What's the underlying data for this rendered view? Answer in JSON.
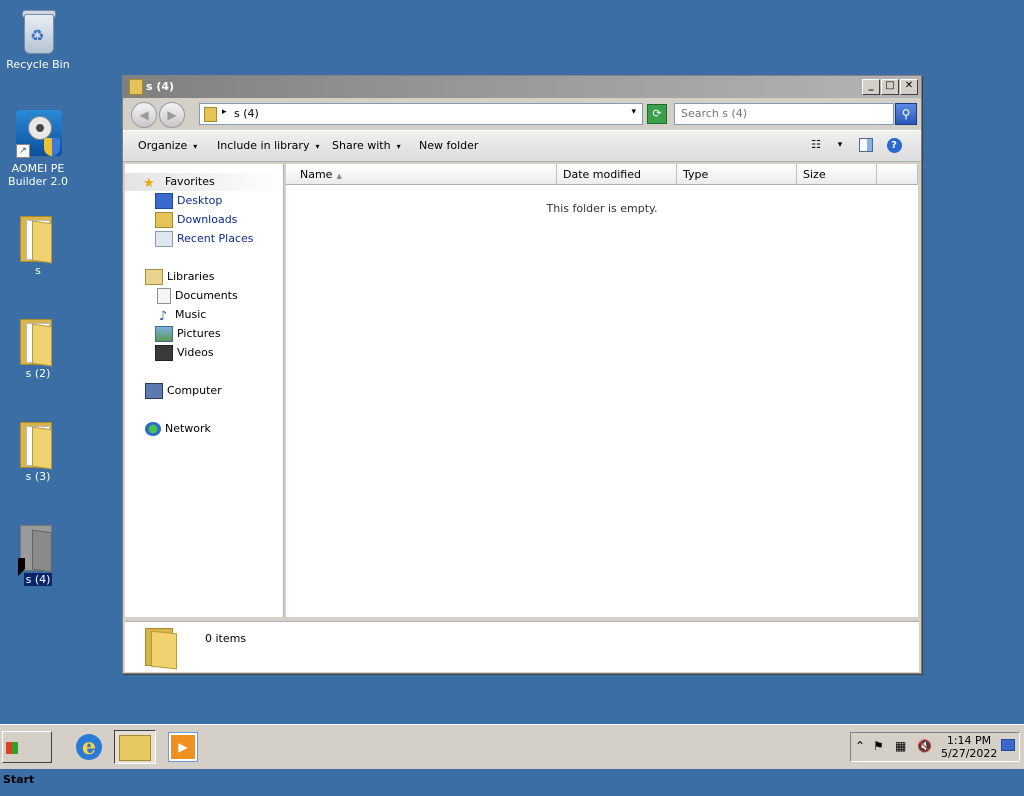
{
  "desktop": {
    "icons": [
      {
        "label": "Recycle Bin",
        "icon": "recycle-bin-icon"
      },
      {
        "label": "AOMEI PE Builder 2.0",
        "line1": "AOMEI PE",
        "line2": "Builder 2.0",
        "icon": "aomei-pe-builder-icon"
      },
      {
        "label": "s",
        "icon": "folder-icon"
      },
      {
        "label": "s (2)",
        "icon": "folder-icon"
      },
      {
        "label": "s (3)",
        "icon": "folder-icon"
      },
      {
        "label": "s (4)",
        "icon": "folder-icon",
        "selected": true
      }
    ]
  },
  "window": {
    "title": "s (4)",
    "controls": {
      "minimize": "_",
      "maximize": "□",
      "close": "✕"
    },
    "address": {
      "path": "s (4)",
      "separator": "▸",
      "dropdown": "▾"
    },
    "search": {
      "placeholder": "Search s (4)"
    },
    "toolbar": {
      "organize": "Organize",
      "include_in_library": "Include in library",
      "share_with": "Share with",
      "new_folder": "New folder",
      "dropdown_glyph": "▾"
    },
    "nav": {
      "favorites": "Favorites",
      "desktop": "Desktop",
      "downloads": "Downloads",
      "recent_places": "Recent Places",
      "libraries": "Libraries",
      "documents": "Documents",
      "music": "Music",
      "pictures": "Pictures",
      "videos": "Videos",
      "computer": "Computer",
      "network": "Network"
    },
    "columns": [
      "Name",
      "Date modified",
      "Type",
      "Size"
    ],
    "empty_message": "This folder is empty.",
    "details": {
      "item_count": "0 items"
    }
  },
  "taskbar": {
    "start_label": "Start",
    "clock": {
      "time": "1:14 PM",
      "date": "5/27/2022"
    },
    "tray_expand": "⌃"
  },
  "colors": {
    "desktop_bg": "#3a6ea5",
    "window_chrome": "#d4d0c8",
    "link_text": "#0b2c8a"
  }
}
